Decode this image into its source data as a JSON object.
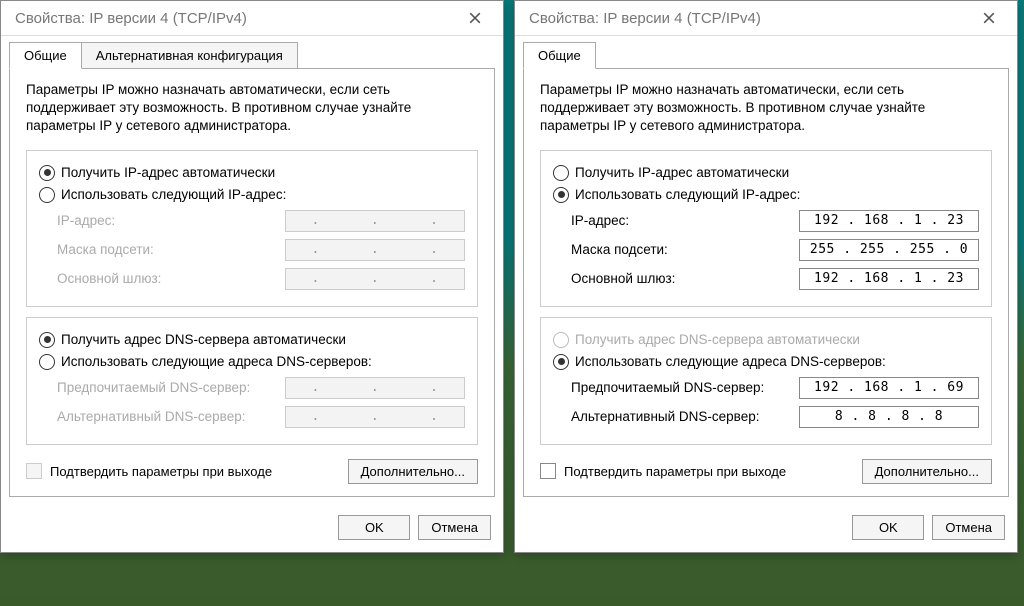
{
  "title": "Свойства: IP версии 4 (TCP/IPv4)",
  "tabs": {
    "general": "Общие",
    "alt": "Альтернативная конфигурация"
  },
  "intro": "Параметры IP можно назначать автоматически, если сеть поддерживает эту возможность. В противном случае узнайте параметры IP у сетевого администратора.",
  "radios": {
    "ip_auto": "Получить IP-адрес автоматически",
    "ip_manual": "Использовать следующий IP-адрес:",
    "dns_auto": "Получить адрес DNS-сервера автоматически",
    "dns_manual": "Использовать следующие адреса DNS-серверов:"
  },
  "labels": {
    "ip": "IP-адрес:",
    "mask": "Маска подсети:",
    "gateway": "Основной шлюз:",
    "dns1": "Предпочитаемый DNS-сервер:",
    "dns2": "Альтернативный DNS-сервер:",
    "validate": "Подтвердить параметры при выходе",
    "advanced": "Дополнительно...",
    "ok": "OK",
    "cancel": "Отмена"
  },
  "left": {
    "ip_mode": "auto",
    "dns_mode": "auto",
    "ip": "",
    "mask": "",
    "gateway": "",
    "dns1": "",
    "dns2": ""
  },
  "right": {
    "ip_mode": "manual",
    "dns_mode": "manual",
    "ip": "192 . 168 .  1  . 23",
    "mask": "255 . 255 . 255 .  0",
    "gateway": "192 . 168 .  1  . 23",
    "dns1": "192 . 168 .  1  . 69",
    "dns2": "8  .  8  .  8  .  8"
  }
}
